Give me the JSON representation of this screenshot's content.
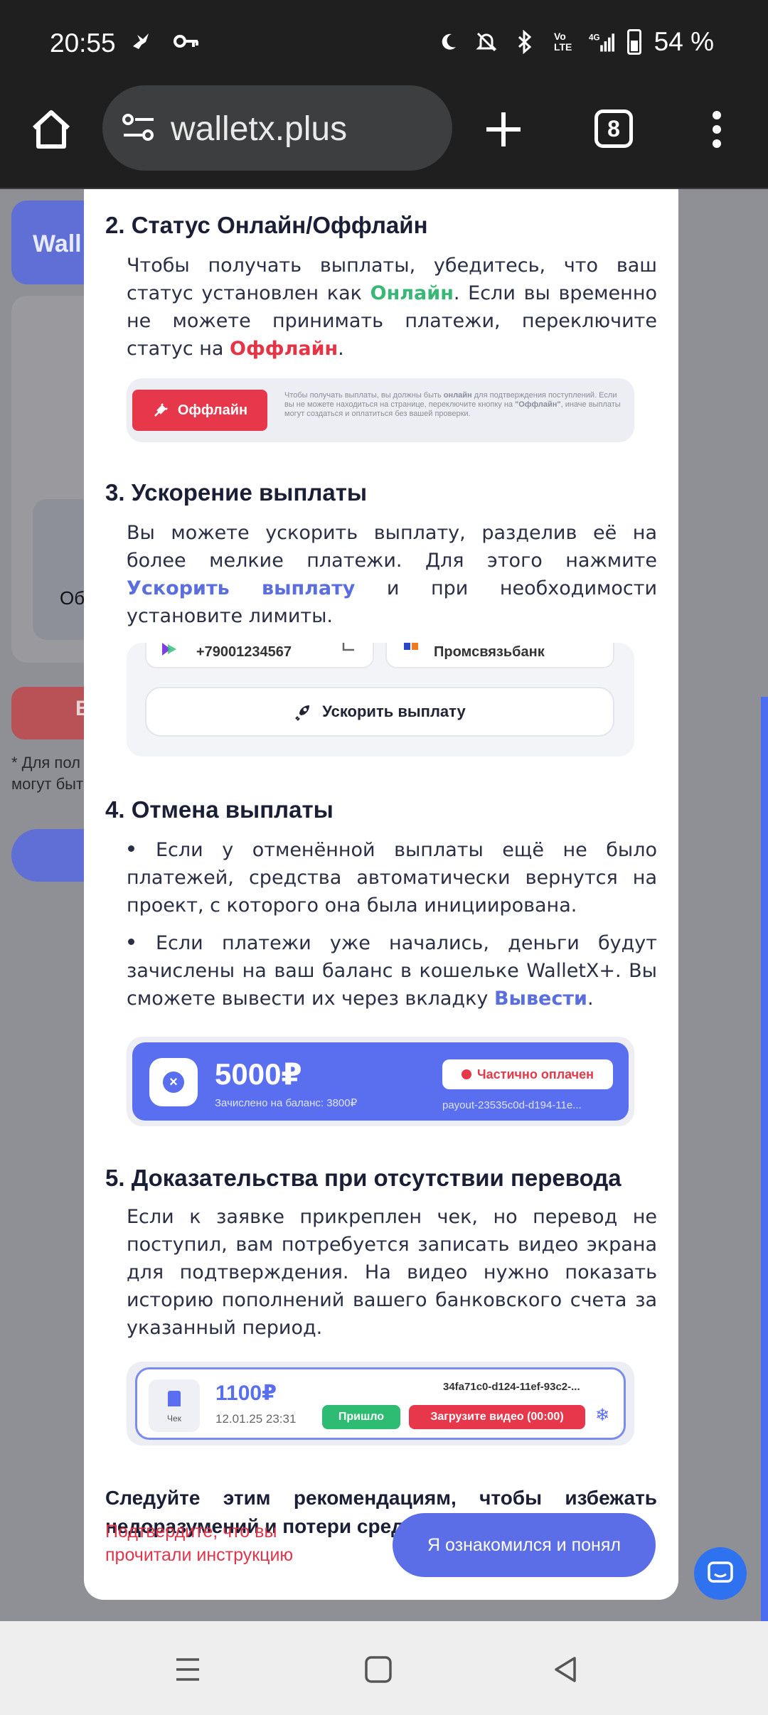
{
  "status_bar": {
    "time": "20:55",
    "battery": "54 %",
    "icons": [
      "bird-icon",
      "key-icon",
      "moon-icon",
      "mute-icon",
      "bluetooth-icon",
      "volte-icon",
      "signal-icon",
      "battery-icon"
    ]
  },
  "browser": {
    "url": "walletx.plus",
    "tab_count": "8"
  },
  "background": {
    "button_label": "Wall",
    "card_text": "Об",
    "red_button_label": "В",
    "note_line1": "* Для пол",
    "note_line2": "могут быт"
  },
  "modal": {
    "section2": {
      "title": "2. Статус Онлайн/Оффлайн",
      "text_a": "Чтобы получать выплаты, убедитесь, что ваш статус установлен как ",
      "online": "Онлайн",
      "text_b": ". Если вы временно не можете принимать платежи, переключите статус на ",
      "offline": "Оффлайн",
      "text_c": ".",
      "mock_button": "Оффлайн",
      "mock_text_a": "Чтобы получать выплаты, вы должны быть ",
      "mock_text_bold": "онлайн",
      "mock_text_b": " для подтверждения поступлений. Если вы не можете находиться на странице, переключите кнопку на ",
      "mock_text_quote": "\"Оффлайн\"",
      "mock_text_c": ", иначе выплаты могут создаться и оплатиться без вашей проверки."
    },
    "section3": {
      "title": "3. Ускорение выплаты",
      "text_a": "Вы можете ускорить выплату, разделив её на более мелкие платежи. Для этого нажмите ",
      "link": "Ускорить выплату",
      "text_b": " и при необходимости установите лимиты.",
      "mock_phone": "+79001234567",
      "mock_bank": "Промсвязьбанк",
      "mock_button": "Ускорить выплату"
    },
    "section4": {
      "title": "4. Отмена выплаты",
      "item1": "Если у отменённой выплаты ещё не было платежей, средства автоматически вернутся на проект, с которого она была инициирована.",
      "item2_a": "Если платежи уже начались, деньги будут зачислены на ваш баланс в кошельке WalletX+. Вы сможете вывести их через вкладку ",
      "item2_link": "Вывести",
      "item2_b": ".",
      "mock_amount": "5000₽",
      "mock_sub": "Зачислено на баланс: 3800₽",
      "mock_badge": "Частично оплачен",
      "mock_id": "payout-23535c0d-d194-11e..."
    },
    "section5": {
      "title": "5. Доказательства при отсутствии перевода",
      "text": "Если к заявке прикреплен чек, но перевод не поступил, вам потребуется записать видео экрана для подтверждения. На видео нужно показать историю пополнений вашего банковского счета за указанный период.",
      "mock_receipt": "Чек",
      "mock_amount": "1100₽",
      "mock_date": "12.01.25 23:31",
      "mock_id": "34fa71c0-d124-11ef-93c2-...",
      "mock_arrived": "Пришло",
      "mock_upload": "Загрузите видео (00:00)"
    },
    "final_text": "Следуйте этим рекомендациям, чтобы избежать недоразумений и потери средств!",
    "confirm_warning": "Подтвердите, что вы прочитали инструкцию",
    "confirm_button": "Я ознакомился и понял"
  },
  "colors": {
    "accent": "#5b6ee8",
    "online_green": "#38b874",
    "offline_red": "#e53445"
  }
}
